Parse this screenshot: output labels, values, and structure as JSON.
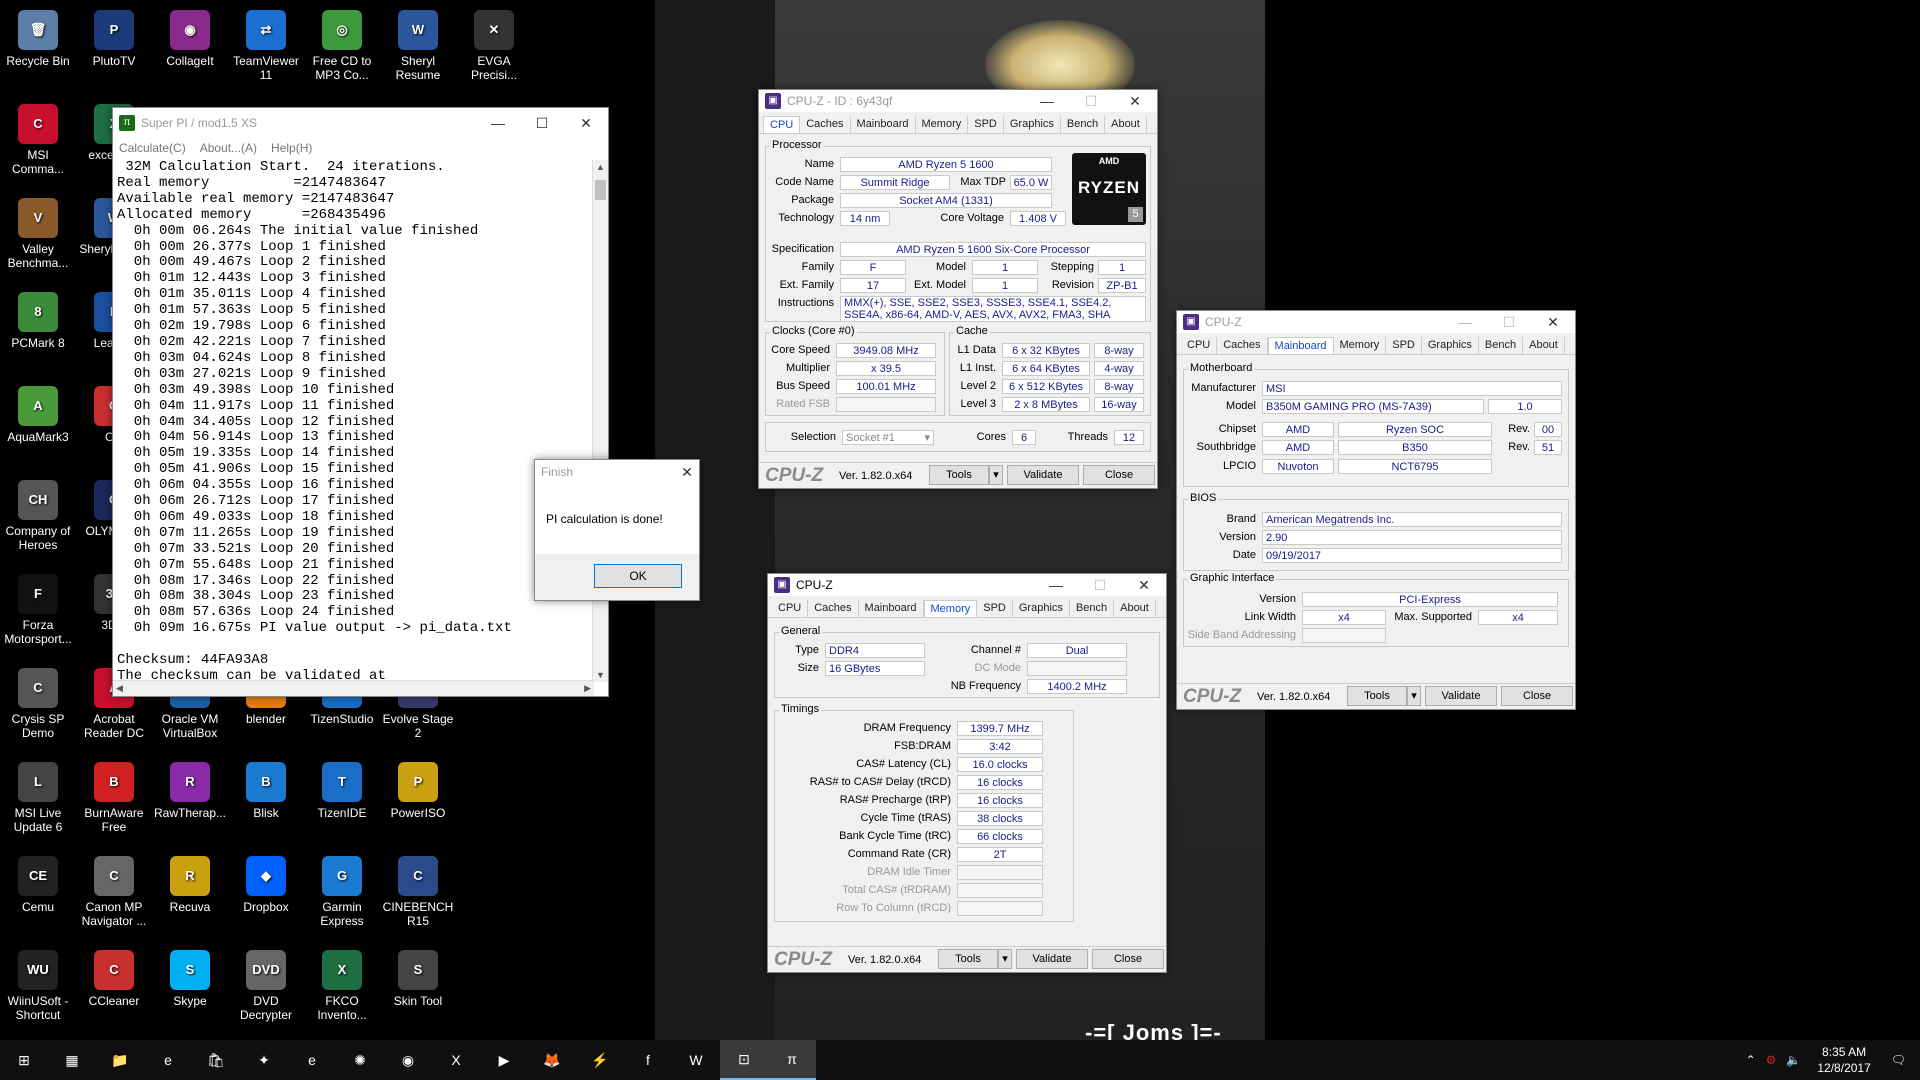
{
  "desktop": {
    "icons": [
      {
        "label": "Recycle Bin",
        "glyph": "🗑",
        "col": 0,
        "row": 0,
        "color": "#5a7fa8"
      },
      {
        "label": "PlutoTV",
        "glyph": "P",
        "col": 1,
        "row": 0,
        "color": "#1a3a7a"
      },
      {
        "label": "CollageIt",
        "glyph": "◉",
        "col": 2,
        "row": 0,
        "color": "#8a2a8a"
      },
      {
        "label": "TeamViewer 11",
        "glyph": "⇄",
        "col": 3,
        "row": 0,
        "color": "#1b6fd0"
      },
      {
        "label": "Free CD to MP3 Co...",
        "glyph": "◎",
        "col": 4,
        "row": 0,
        "color": "#3c9a3c"
      },
      {
        "label": "Sheryl Resume",
        "glyph": "W",
        "col": 5,
        "row": 0,
        "color": "#2b579a"
      },
      {
        "label": "EVGA Precisi...",
        "glyph": "✕",
        "col": 6,
        "row": 0,
        "color": "#333"
      },
      {
        "label": "MSI Comma...",
        "glyph": "C",
        "col": 0,
        "row": 1,
        "color": "#c8102e"
      },
      {
        "label": "excel t 10",
        "glyph": "X",
        "col": 1,
        "row": 1,
        "color": "#1d6f42"
      },
      {
        "label": "Valley Benchma...",
        "glyph": "V",
        "col": 0,
        "row": 2,
        "color": "#8a5a2a"
      },
      {
        "label": "Sheryl Cover",
        "glyph": "W",
        "col": 1,
        "row": 2,
        "color": "#2b579a"
      },
      {
        "label": "PCMark 8",
        "glyph": "8",
        "col": 0,
        "row": 3,
        "color": "#3c8a3c"
      },
      {
        "label": "Lea Blu",
        "glyph": "L",
        "col": 1,
        "row": 3,
        "color": "#1b4fa0"
      },
      {
        "label": "AquaMark3",
        "glyph": "A",
        "col": 0,
        "row": 4,
        "color": "#4a9a3a"
      },
      {
        "label": "OC",
        "glyph": "O",
        "col": 1,
        "row": 4,
        "color": "#c83030"
      },
      {
        "label": "Company of Heroes",
        "glyph": "CH",
        "col": 0,
        "row": 5,
        "color": "#555"
      },
      {
        "label": "OLYM Digi",
        "glyph": "O",
        "col": 1,
        "row": 5,
        "color": "#1a2a5a"
      },
      {
        "label": "Forza Motorsport...",
        "glyph": "F",
        "col": 0,
        "row": 6,
        "color": "#111"
      },
      {
        "label": "3DM",
        "glyph": "3D",
        "col": 1,
        "row": 6,
        "color": "#333"
      },
      {
        "label": "Crysis SP Demo",
        "glyph": "C",
        "col": 0,
        "row": 7,
        "color": "#555"
      },
      {
        "label": "Acrobat Reader DC",
        "glyph": "A",
        "col": 1,
        "row": 7,
        "color": "#c8102e"
      },
      {
        "label": "Oracle VM VirtualBox",
        "glyph": "VB",
        "col": 2,
        "row": 7,
        "color": "#1b5fa8"
      },
      {
        "label": "blender",
        "glyph": "b",
        "col": 3,
        "row": 7,
        "color": "#e87d0d"
      },
      {
        "label": "TizenStudio",
        "glyph": "T",
        "col": 4,
        "row": 7,
        "color": "#1a6ec8"
      },
      {
        "label": "Evolve Stage 2",
        "glyph": "E",
        "col": 5,
        "row": 7,
        "color": "#3a3a6a"
      },
      {
        "label": "MSI Live Update 6",
        "glyph": "L",
        "col": 0,
        "row": 8,
        "color": "#444"
      },
      {
        "label": "BurnAware Free",
        "glyph": "B",
        "col": 1,
        "row": 8,
        "color": "#d02020"
      },
      {
        "label": "RawTherap...",
        "glyph": "R",
        "col": 2,
        "row": 8,
        "color": "#8a2aa8"
      },
      {
        "label": "Blisk",
        "glyph": "B",
        "col": 3,
        "row": 8,
        "color": "#1a7ad0"
      },
      {
        "label": "TizenIDE",
        "glyph": "T",
        "col": 4,
        "row": 8,
        "color": "#1a6ec8"
      },
      {
        "label": "PowerISO",
        "glyph": "P",
        "col": 5,
        "row": 8,
        "color": "#c8a010"
      },
      {
        "label": "Cemu",
        "glyph": "CE",
        "col": 0,
        "row": 9,
        "color": "#222"
      },
      {
        "label": "Canon MP Navigator ...",
        "glyph": "C",
        "col": 1,
        "row": 9,
        "color": "#666"
      },
      {
        "label": "Recuva",
        "glyph": "R",
        "col": 2,
        "row": 9,
        "color": "#c8a010"
      },
      {
        "label": "Dropbox",
        "glyph": "◆",
        "col": 3,
        "row": 9,
        "color": "#0061fe"
      },
      {
        "label": "Garmin Express",
        "glyph": "G",
        "col": 4,
        "row": 9,
        "color": "#1a7ad0"
      },
      {
        "label": "CINEBENCH R15",
        "glyph": "C",
        "col": 5,
        "row": 9,
        "color": "#2a4a8a"
      },
      {
        "label": "WiinUSoft - Shortcut",
        "glyph": "WU",
        "col": 0,
        "row": 10,
        "color": "#222"
      },
      {
        "label": "CCleaner",
        "glyph": "C",
        "col": 1,
        "row": 10,
        "color": "#c83030"
      },
      {
        "label": "Skype",
        "glyph": "S",
        "col": 2,
        "row": 10,
        "color": "#00aff0"
      },
      {
        "label": "DVD Decrypter",
        "glyph": "DVD",
        "col": 3,
        "row": 10,
        "color": "#666"
      },
      {
        "label": "FKCO Invento...",
        "glyph": "X",
        "col": 4,
        "row": 10,
        "color": "#1d6f42"
      },
      {
        "label": "Skin Tool",
        "glyph": "S",
        "col": 5,
        "row": 10,
        "color": "#444"
      }
    ],
    "watermark": "-=[ Joms ]=-"
  },
  "superpi": {
    "title": "Super PI / mod1.5 XS",
    "menu": [
      "Calculate(C)",
      "About...(A)",
      "Help(H)"
    ],
    "output": " 32M Calculation Start.  24 iterations.\nReal memory          =2147483647\nAvailable real memory =2147483647\nAllocated memory      =268435496\n  0h 00m 06.264s The initial value finished\n  0h 00m 26.377s Loop 1 finished\n  0h 00m 49.467s Loop 2 finished\n  0h 01m 12.443s Loop 3 finished\n  0h 01m 35.011s Loop 4 finished\n  0h 01m 57.363s Loop 5 finished\n  0h 02m 19.798s Loop 6 finished\n  0h 02m 42.221s Loop 7 finished\n  0h 03m 04.624s Loop 8 finished\n  0h 03m 27.021s Loop 9 finished\n  0h 03m 49.398s Loop 10 finished\n  0h 04m 11.917s Loop 11 finished\n  0h 04m 34.405s Loop 12 finished\n  0h 04m 56.914s Loop 13 finished\n  0h 05m 19.335s Loop 14 finished\n  0h 05m 41.906s Loop 15 finished\n  0h 06m 04.355s Loop 16 finished\n  0h 06m 26.712s Loop 17 finished\n  0h 06m 49.033s Loop 18 finished\n  0h 07m 11.265s Loop 19 finished\n  0h 07m 33.521s Loop 20 finished\n  0h 07m 55.648s Loop 21 finished\n  0h 08m 17.346s Loop 22 finished\n  0h 08m 38.304s Loop 23 finished\n  0h 08m 57.636s Loop 24 finished\n  0h 09m 16.675s PI value output -> pi_data.txt\n\nChecksum: 44FA93A8\nThe checksum can be validated at"
  },
  "finish": {
    "title": "Finish",
    "message": "PI calculation is done!",
    "ok": "OK"
  },
  "tabs": [
    "CPU",
    "Caches",
    "Mainboard",
    "Memory",
    "SPD",
    "Graphics",
    "Bench",
    "About"
  ],
  "footer": {
    "brand": "CPU-Z",
    "version": "Ver. 1.82.0.x64",
    "tools": "Tools",
    "validate": "Validate",
    "close": "Close"
  },
  "cpuz_cpu": {
    "title": "CPU-Z - ID : 6y43qf",
    "processor_label": "Processor",
    "name_label": "Name",
    "name": "AMD Ryzen 5 1600",
    "codename_label": "Code Name",
    "codename": "Summit Ridge",
    "maxtdp_label": "Max TDP",
    "maxtdp": "65.0 W",
    "package_label": "Package",
    "package": "Socket AM4 (1331)",
    "tech_label": "Technology",
    "tech": "14 nm",
    "cv_label": "Core Voltage",
    "cv": "1.408 V",
    "spec_label": "Specification",
    "spec": "AMD Ryzen 5 1600 Six-Core Processor",
    "family_label": "Family",
    "family": "F",
    "model_label": "Model",
    "model": "1",
    "stepping_label": "Stepping",
    "stepping": "1",
    "extfam_label": "Ext. Family",
    "extfam": "17",
    "extmodel_label": "Ext. Model",
    "extmodel": "1",
    "revision_label": "Revision",
    "revision": "ZP-B1",
    "instr_label": "Instructions",
    "instr": "MMX(+), SSE, SSE2, SSE3, SSSE3, SSE4.1, SSE4.2, SSE4A, x86-64, AMD-V, AES, AVX, AVX2, FMA3, SHA",
    "logo_top": "AMD",
    "logo_main": "RYZEN",
    "logo_num": "5",
    "clocks_label": "Clocks (Core #0)",
    "corespeed_label": "Core Speed",
    "corespeed": "3949.08 MHz",
    "mult_label": "Multiplier",
    "mult": "x 39.5",
    "bus_label": "Bus Speed",
    "bus": "100.01 MHz",
    "fsb_label": "Rated FSB",
    "cache_label": "Cache",
    "l1d_label": "L1 Data",
    "l1d": "6 x 32 KBytes",
    "l1d_w": "8-way",
    "l1i_label": "L1 Inst.",
    "l1i": "6 x 64 KBytes",
    "l1i_w": "4-way",
    "l2_label": "Level 2",
    "l2": "6 x 512 KBytes",
    "l2_w": "8-way",
    "l3_label": "Level 3",
    "l3": "2 x 8 MBytes",
    "l3_w": "16-way",
    "sel_label": "Selection",
    "sel": "Socket #1",
    "cores_label": "Cores",
    "cores": "6",
    "threads_label": "Threads",
    "threads": "12"
  },
  "cpuz_mb": {
    "title": "CPU-Z",
    "mb_label": "Motherboard",
    "manu_label": "Manufacturer",
    "manu": "MSI",
    "model_label": "Model",
    "model": "B350M GAMING PRO (MS-7A39)",
    "model_rev": "1.0",
    "chipset_label": "Chipset",
    "chipset_v": "AMD",
    "chipset_n": "Ryzen SOC",
    "rev_label": "Rev.",
    "chipset_rev": "00",
    "sb_label": "Southbridge",
    "sb_v": "AMD",
    "sb_n": "B350",
    "sb_rev": "51",
    "lpcio_label": "LPCIO",
    "lpcio_v": "Nuvoton",
    "lpcio_n": "NCT6795",
    "bios_label": "BIOS",
    "brand_label": "Brand",
    "brand": "American Megatrends Inc.",
    "ver_label": "Version",
    "ver": "2.90",
    "date_label": "Date",
    "date": "09/19/2017",
    "gi_label": "Graphic Interface",
    "giver_label": "Version",
    "giver": "PCI-Express",
    "lw_label": "Link Width",
    "lw": "x4",
    "ms_label": "Max. Supported",
    "ms": "x4",
    "sba_label": "Side Band Addressing"
  },
  "cpuz_mem": {
    "title": "CPU-Z",
    "gen_label": "General",
    "type_label": "Type",
    "type": "DDR4",
    "size_label": "Size",
    "size": "16 GBytes",
    "ch_label": "Channel #",
    "ch": "Dual",
    "dc_label": "DC Mode",
    "nb_label": "NB Frequency",
    "nb": "1400.2 MHz",
    "tim_label": "Timings",
    "timings": [
      {
        "label": "DRAM Frequency",
        "value": "1399.7 MHz"
      },
      {
        "label": "FSB:DRAM",
        "value": "3:42"
      },
      {
        "label": "CAS# Latency (CL)",
        "value": "16.0 clocks"
      },
      {
        "label": "RAS# to CAS# Delay (tRCD)",
        "value": "16 clocks"
      },
      {
        "label": "RAS# Precharge (tRP)",
        "value": "16 clocks"
      },
      {
        "label": "Cycle Time (tRAS)",
        "value": "38 clocks"
      },
      {
        "label": "Bank Cycle Time (tRC)",
        "value": "66 clocks"
      },
      {
        "label": "Command Rate (CR)",
        "value": "2T"
      }
    ],
    "timings_grey": [
      "DRAM Idle Timer",
      "Total CAS# (tRDRAM)",
      "Row To Column (tRCD)"
    ]
  },
  "taskbar": {
    "apps": [
      "⊞",
      "▦",
      "📁",
      "e",
      "🛍",
      "✦",
      "e",
      "✺",
      "◉",
      "X",
      "▶",
      "🦊",
      "⚡",
      "f",
      "W",
      "⊡",
      "π"
    ],
    "time": "8:35 AM",
    "date": "12/8/2017"
  }
}
